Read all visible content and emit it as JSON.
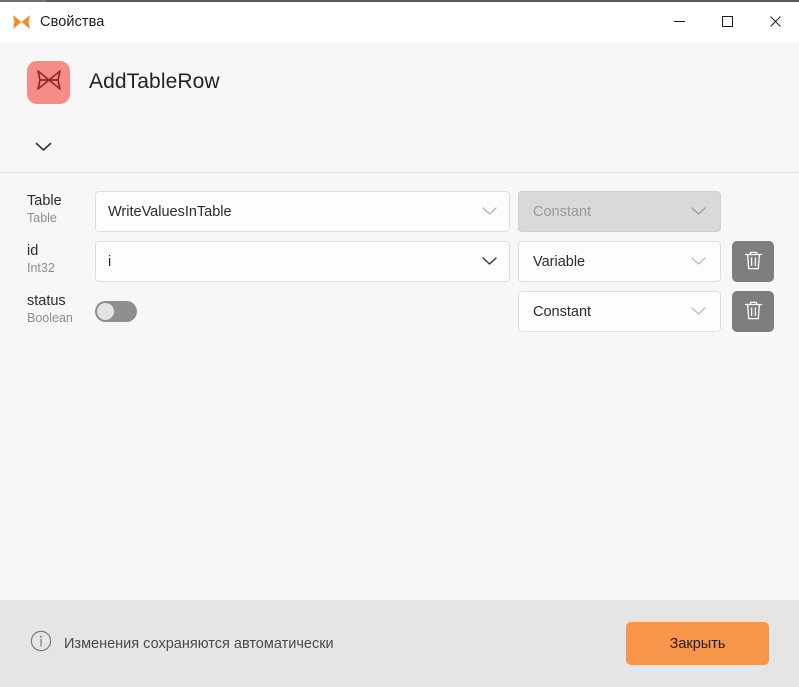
{
  "window": {
    "title": "Свойства",
    "icon": "butterfly-icon",
    "controls": {
      "minimize": "minimize-icon",
      "maximize": "maximize-icon",
      "close": "close-icon"
    }
  },
  "header": {
    "logo_icon": "butterfly-icon",
    "logo_bg": "#f78b85",
    "logo_fg": "#8c2a2a",
    "title": "AddTableRow"
  },
  "collapse": {
    "icon": "chevron-down-icon"
  },
  "parameters": [
    {
      "name": "Table",
      "type": "Table",
      "control": "combo",
      "value": "WriteValuesInTable",
      "source": "Constant",
      "source_disabled": true,
      "has_delete": false,
      "chevron": "chevron-down-icon"
    },
    {
      "name": "id",
      "type": "Int32",
      "control": "combo",
      "value": "i",
      "source": "Variable",
      "source_disabled": false,
      "has_delete": true,
      "chevron": "chevron-down-icon",
      "delete_icon": "trash-icon"
    },
    {
      "name": "status",
      "type": "Boolean",
      "control": "toggle",
      "value": "",
      "toggle_on": false,
      "source": "Constant",
      "source_disabled": false,
      "has_delete": true,
      "delete_icon": "trash-icon"
    }
  ],
  "footer": {
    "info_icon": "info-circle-icon",
    "note": "Изменения сохраняются автоматически",
    "close_label": "Закрыть",
    "close_color": "#f7964a"
  }
}
